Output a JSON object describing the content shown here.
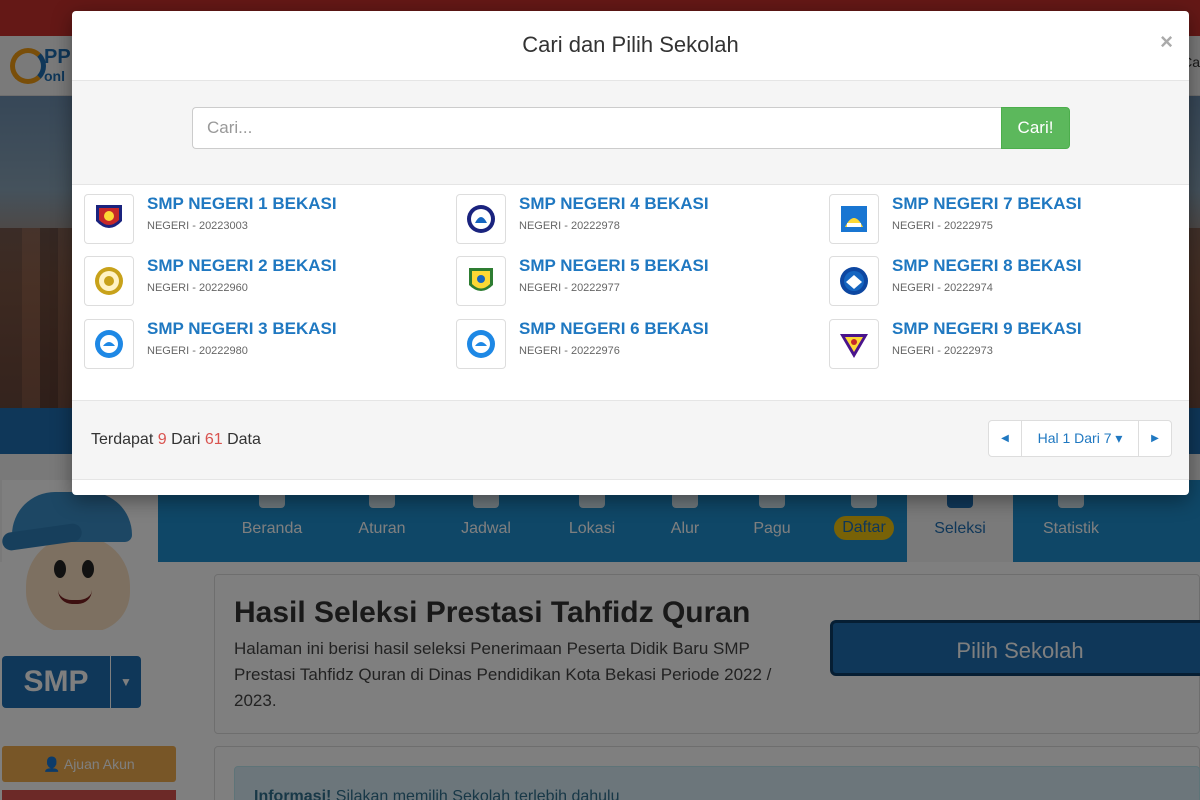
{
  "background": {
    "brand_right": "Ca",
    "logo_text1": "PP",
    "logo_text2": "onl",
    "nav": {
      "items": [
        {
          "label": "Beranda"
        },
        {
          "label": "Aturan"
        },
        {
          "label": "Jadwal"
        },
        {
          "label": "Lokasi"
        },
        {
          "label": "Alur"
        },
        {
          "label": "Pagu"
        },
        {
          "label": "Daftar"
        },
        {
          "label": "Seleksi",
          "active": true
        },
        {
          "label": "Statistik"
        }
      ]
    },
    "level_button": "SMP",
    "ajuan_button": "Ajuan Akun",
    "page_title": "Hasil Seleksi Prestasi Tahfidz Quran",
    "page_desc": "Halaman ini berisi hasil seleksi Penerimaan Peserta Didik Baru SMP Prestasi Tahfidz Quran di Dinas Pendidikan Kota Bekasi Periode 2022 / 2023.",
    "pilih_button": "Pilih Sekolah",
    "info_bold": "Informasi!",
    "info_text": " Silakan memilih Sekolah terlebih dahulu"
  },
  "modal": {
    "title": "Cari dan Pilih Sekolah",
    "close": "×",
    "search": {
      "placeholder": "Cari...",
      "button": "Cari!"
    },
    "schools": [
      {
        "name": "SMP NEGERI 1 BEKASI",
        "code": "NEGERI - 20223003"
      },
      {
        "name": "SMP NEGERI 2 BEKASI",
        "code": "NEGERI - 20222960"
      },
      {
        "name": "SMP NEGERI 3 BEKASI",
        "code": "NEGERI - 20222980"
      },
      {
        "name": "SMP NEGERI 4 BEKASI",
        "code": "NEGERI - 20222978"
      },
      {
        "name": "SMP NEGERI 5 BEKASI",
        "code": "NEGERI - 20222977"
      },
      {
        "name": "SMP NEGERI 6 BEKASI",
        "code": "NEGERI - 20222976"
      },
      {
        "name": "SMP NEGERI 7 BEKASI",
        "code": "NEGERI - 20222975"
      },
      {
        "name": "SMP NEGERI 8 BEKASI",
        "code": "NEGERI - 20222974"
      },
      {
        "name": "SMP NEGERI 9 BEKASI",
        "code": "NEGERI - 20222973"
      }
    ],
    "footer": {
      "prefix": "Terdapat ",
      "shown": "9",
      "middle": " Dari ",
      "total": "61",
      "suffix": " Data"
    },
    "pager": {
      "prev": "◀",
      "label": "Hal 1 Dari 7 ▾",
      "next": "▶"
    }
  }
}
